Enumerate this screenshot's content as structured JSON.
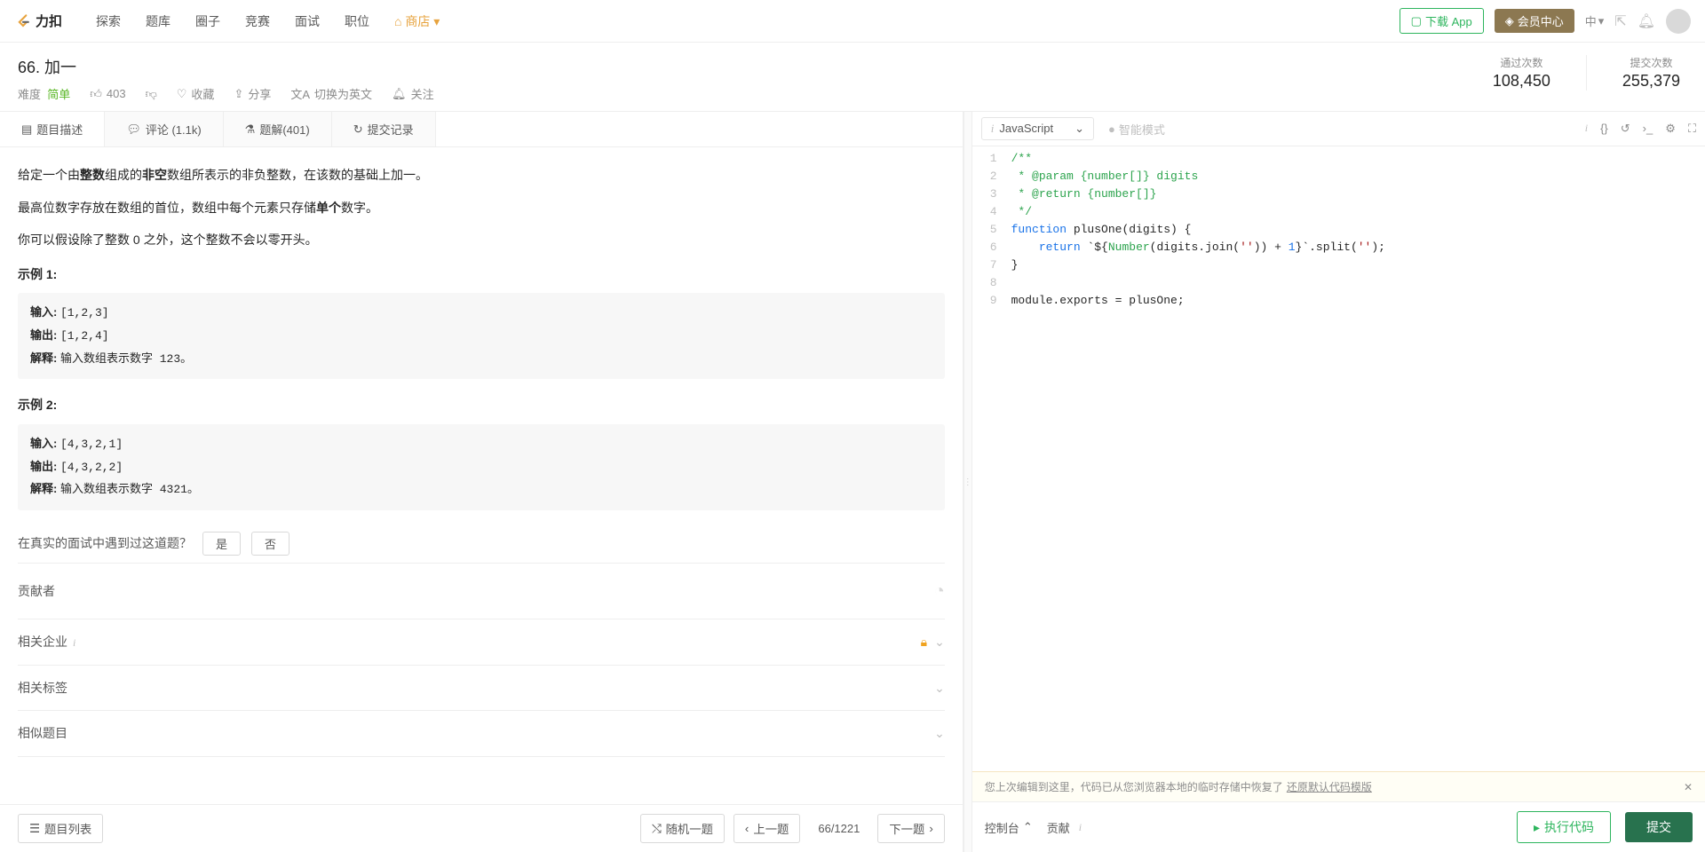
{
  "nav": {
    "brand": "力扣",
    "links": [
      "探索",
      "题库",
      "圈子",
      "竞赛",
      "面试",
      "职位"
    ],
    "store": "商店",
    "download": "下载 App",
    "member": "会员中心",
    "lang": "中"
  },
  "problem": {
    "title": "66. 加一",
    "difficulty_label": "难度",
    "difficulty_value": "简单",
    "likes": "403",
    "favorite": "收藏",
    "share": "分享",
    "switch_lang": "切换为英文",
    "follow": "关注",
    "stats": {
      "accepted_label": "通过次数",
      "accepted_value": "108,450",
      "submissions_label": "提交次数",
      "submissions_value": "255,379"
    }
  },
  "tabs": {
    "description": "题目描述",
    "comments": "评论 (1.1k)",
    "solutions": "题解(401)",
    "submissions": "提交记录"
  },
  "description": {
    "p1_a": "给定一个由",
    "p1_b": "整数",
    "p1_c": "组成的",
    "p1_d": "非空",
    "p1_e": "数组所表示的非负整数，在该数的基础上加一。",
    "p2_a": "最高位数字存放在数组的首位，数组中每个元素只存储",
    "p2_b": "单个",
    "p2_c": "数字。",
    "p3": "你可以假设除了整数 0 之外，这个整数不会以零开头。",
    "ex1_label": "示例 1:",
    "ex2_label": "示例 2:",
    "input_label": "输入: ",
    "output_label": "输出: ",
    "explain_label": "解释: ",
    "ex1_input": "[1,2,3]",
    "ex1_output": "[1,2,4]",
    "ex1_explain": "输入数组表示数字 123。",
    "ex2_input": "[4,3,2,1]",
    "ex2_output": "[4,3,2,2]",
    "ex2_explain": "输入数组表示数字 4321。"
  },
  "interview": {
    "question": "在真实的面试中遇到过这道题？",
    "yes": "是",
    "no": "否"
  },
  "accordion": {
    "contributors": "贡献者",
    "companies": "相关企业",
    "tags": "相关标签",
    "similar": "相似题目"
  },
  "left_footer": {
    "list": "题目列表",
    "random": "随机一题",
    "prev": "上一题",
    "page": "66/1221",
    "next": "下一题"
  },
  "editor": {
    "language": "JavaScript",
    "smart_mode": "智能模式",
    "code_lines": [
      {
        "n": 1,
        "segs": [
          {
            "t": "/**",
            "c": "tok-comment"
          }
        ]
      },
      {
        "n": 2,
        "segs": [
          {
            "t": " * @param {number[]} digits",
            "c": "tok-comment"
          }
        ]
      },
      {
        "n": 3,
        "segs": [
          {
            "t": " * @return {number[]}",
            "c": "tok-comment"
          }
        ]
      },
      {
        "n": 4,
        "segs": [
          {
            "t": " */",
            "c": "tok-comment"
          }
        ]
      },
      {
        "n": 5,
        "segs": [
          {
            "t": "function",
            "c": "tok-keyword"
          },
          {
            "t": " plusOne(digits) {",
            "c": ""
          }
        ]
      },
      {
        "n": 6,
        "segs": [
          {
            "t": "    ",
            "c": ""
          },
          {
            "t": "return",
            "c": "tok-keyword"
          },
          {
            "t": " `${",
            "c": ""
          },
          {
            "t": "Number",
            "c": "tok-type"
          },
          {
            "t": "(digits.join(",
            "c": ""
          },
          {
            "t": "''",
            "c": "tok-string"
          },
          {
            "t": ")) + ",
            "c": ""
          },
          {
            "t": "1",
            "c": "tok-number"
          },
          {
            "t": "}`.split(",
            "c": ""
          },
          {
            "t": "''",
            "c": "tok-string"
          },
          {
            "t": ");",
            "c": ""
          }
        ]
      },
      {
        "n": 7,
        "segs": [
          {
            "t": "}",
            "c": ""
          }
        ]
      },
      {
        "n": 8,
        "segs": [
          {
            "t": "",
            "c": ""
          }
        ]
      },
      {
        "n": 9,
        "segs": [
          {
            "t": "module.exports = plusOne;",
            "c": ""
          }
        ]
      }
    ],
    "restore_msg": "您上次编辑到这里，代码已从您浏览器本地的临时存储中恢复了",
    "restore_link": "还原默认代码模版"
  },
  "right_footer": {
    "console": "控制台",
    "contribute": "贡献",
    "run": "执行代码",
    "submit": "提交"
  }
}
